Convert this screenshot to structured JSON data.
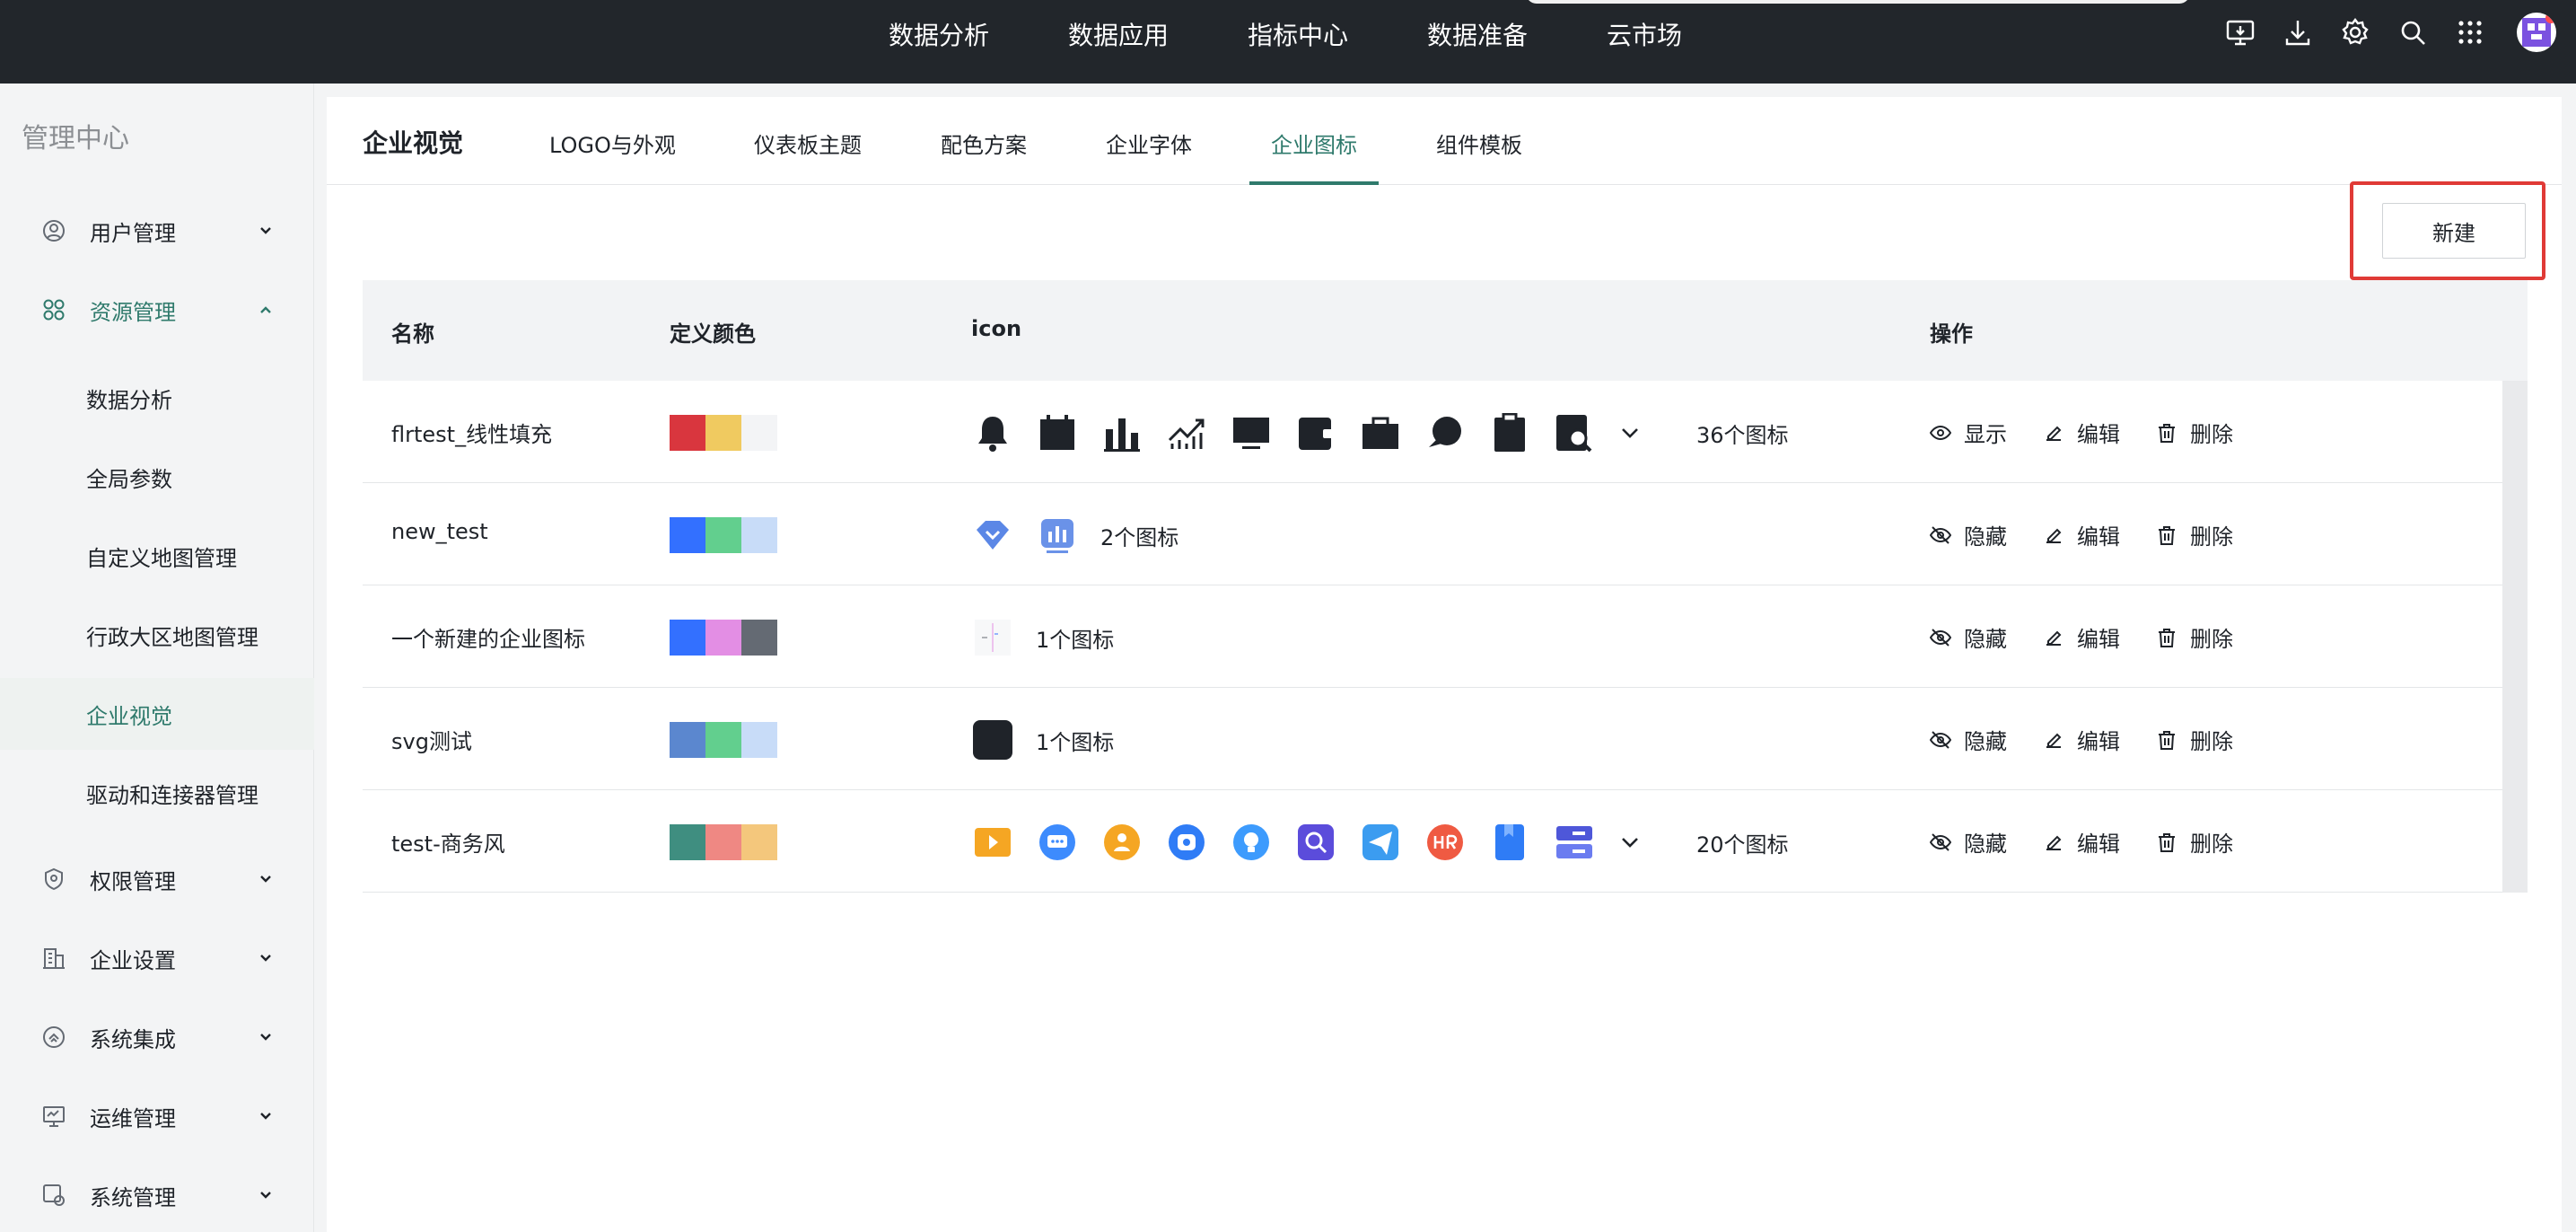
{
  "topnav": {
    "items": [
      "数据分析",
      "数据应用",
      "指标中心",
      "数据准备",
      "云市场"
    ]
  },
  "topicons": [
    "screen-download-icon",
    "download-icon",
    "gear-icon",
    "search-icon",
    "apps-grid-icon"
  ],
  "sidebar": {
    "title": "管理中心",
    "items": [
      {
        "label": "用户管理",
        "icon": "user-icon",
        "expanded": false
      },
      {
        "label": "资源管理",
        "icon": "resource-grid-icon",
        "expanded": true,
        "children": [
          "数据分析",
          "全局参数",
          "自定义地图管理",
          "行政大区地图管理",
          "企业视觉",
          "驱动和连接器管理"
        ]
      },
      {
        "label": "权限管理",
        "icon": "shield-icon",
        "expanded": false
      },
      {
        "label": "企业设置",
        "icon": "building-icon",
        "expanded": false
      },
      {
        "label": "系统集成",
        "icon": "integration-icon",
        "expanded": false
      },
      {
        "label": "运维管理",
        "icon": "monitor-icon",
        "expanded": false
      },
      {
        "label": "系统管理",
        "icon": "system-gear-icon",
        "expanded": false
      }
    ],
    "active_child": "企业视觉"
  },
  "tabs": {
    "title": "企业视觉",
    "items": [
      "LOGO与外观",
      "仪表板主题",
      "配色方案",
      "企业字体",
      "企业图标",
      "组件模板"
    ],
    "active": "企业图标"
  },
  "new_button": "新建",
  "table": {
    "headers": [
      "名称",
      "定义颜色",
      "icon",
      "操作"
    ],
    "rows": [
      {
        "name": "flrtest_线性填充",
        "colors": [
          "#d9363e",
          "#f0ca60",
          "#f3f4f6"
        ],
        "icon_count": "36个图标",
        "visibility": "显示",
        "edit": "编辑",
        "delete": "删除",
        "expand": true
      },
      {
        "name": "new_test",
        "colors": [
          "#3370ff",
          "#62cf8e",
          "#c8dcf8"
        ],
        "icon_count": "2个图标",
        "visibility": "隐藏",
        "edit": "编辑",
        "delete": "删除",
        "expand": false
      },
      {
        "name": "一个新建的企业图标",
        "colors": [
          "#3370ff",
          "#e38ee4",
          "#646a73"
        ],
        "icon_count": "1个图标",
        "visibility": "隐藏",
        "edit": "编辑",
        "delete": "删除",
        "expand": false
      },
      {
        "name": "svg测试",
        "colors": [
          "#5b87cf",
          "#62cf8e",
          "#c8dcf8"
        ],
        "icon_count": "1个图标",
        "visibility": "隐藏",
        "edit": "编辑",
        "delete": "删除",
        "expand": false
      },
      {
        "name": "test-商务风",
        "colors": [
          "#3f8e80",
          "#ef8883",
          "#f4c77c"
        ],
        "icon_count": "20个图标",
        "visibility": "隐藏",
        "edit": "编辑",
        "delete": "删除",
        "expand": true
      }
    ]
  }
}
